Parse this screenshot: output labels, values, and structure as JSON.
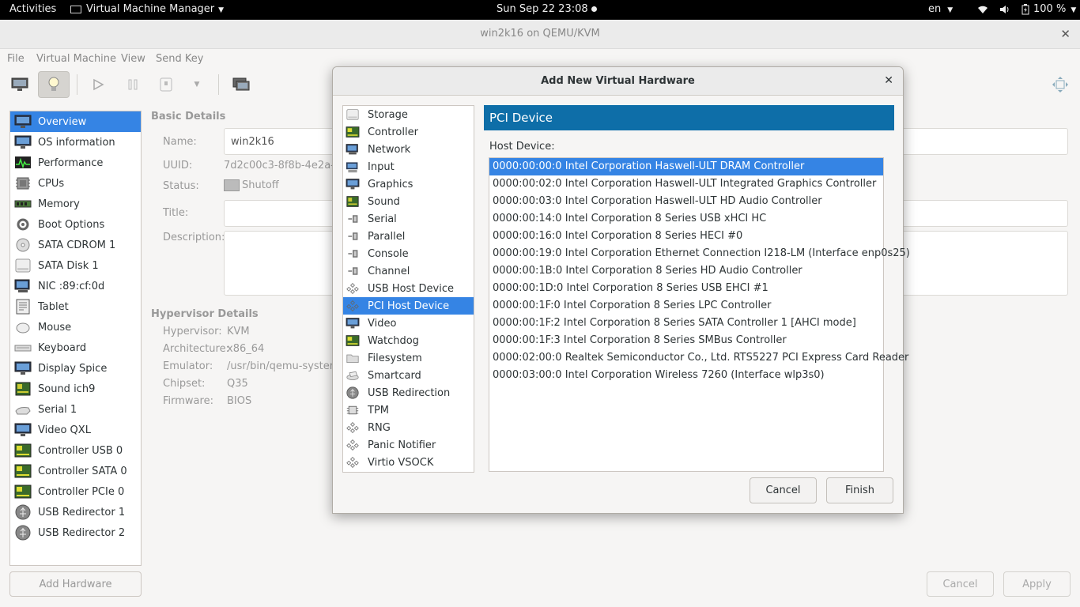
{
  "topbar": {
    "activities": "Activities",
    "app_name": "Virtual Machine Manager",
    "clock": "Sun Sep 22  23:08",
    "lang": "en",
    "battery": "100 %"
  },
  "window": {
    "title": "win2k16 on QEMU/KVM",
    "close": "✕"
  },
  "menu": [
    "File",
    "Virtual Machine",
    "View",
    "Send Key"
  ],
  "hardware_list": {
    "items": [
      {
        "label": "Overview",
        "icon": "monitor-icon"
      },
      {
        "label": "OS information",
        "icon": "monitor-icon"
      },
      {
        "label": "Performance",
        "icon": "performance-icon"
      },
      {
        "label": "CPUs",
        "icon": "cpu-icon"
      },
      {
        "label": "Memory",
        "icon": "memory-icon"
      },
      {
        "label": "Boot Options",
        "icon": "gear-icon"
      },
      {
        "label": "SATA CDROM 1",
        "icon": "cdrom-icon"
      },
      {
        "label": "SATA Disk 1",
        "icon": "disk-icon"
      },
      {
        "label": "NIC :89:cf:0d",
        "icon": "network-icon"
      },
      {
        "label": "Tablet",
        "icon": "tablet-icon"
      },
      {
        "label": "Mouse",
        "icon": "mouse-icon"
      },
      {
        "label": "Keyboard",
        "icon": "keyboard-icon"
      },
      {
        "label": "Display Spice",
        "icon": "monitor-icon"
      },
      {
        "label": "Sound ich9",
        "icon": "sound-card-icon"
      },
      {
        "label": "Serial 1",
        "icon": "serial-icon"
      },
      {
        "label": "Video QXL",
        "icon": "monitor-icon"
      },
      {
        "label": "Controller USB 0",
        "icon": "card-icon"
      },
      {
        "label": "Controller SATA 0",
        "icon": "card-icon"
      },
      {
        "label": "Controller PCIe 0",
        "icon": "card-icon"
      },
      {
        "label": "USB Redirector 1",
        "icon": "usb-icon"
      },
      {
        "label": "USB Redirector 2",
        "icon": "usb-icon"
      }
    ],
    "add_button": "Add Hardware"
  },
  "details": {
    "basic_header": "Basic Details",
    "name_label": "Name:",
    "name_value": "win2k16",
    "uuid_label": "UUID:",
    "uuid_value": "7d2c00c3-8f8b-4e2a-a",
    "status_label": "Status:",
    "status_value": "Shutoff",
    "title_label": "Title:",
    "description_label": "Description:",
    "hypervisor_header": "Hypervisor Details",
    "hypervisor_label": "Hypervisor:",
    "hypervisor_value": "KVM",
    "architecture_label": "Architecture:",
    "architecture_value": "x86_64",
    "emulator_label": "Emulator:",
    "emulator_value": "/usr/bin/qemu-system-",
    "chipset_label": "Chipset:",
    "chipset_value": "Q35",
    "firmware_label": "Firmware:",
    "firmware_value": "BIOS",
    "cancel": "Cancel",
    "apply": "Apply"
  },
  "dialog": {
    "title": "Add New Virtual Hardware",
    "close": "✕",
    "types": [
      {
        "label": "Storage",
        "icon": "disk-icon"
      },
      {
        "label": "Controller",
        "icon": "card-icon"
      },
      {
        "label": "Network",
        "icon": "network-icon"
      },
      {
        "label": "Input",
        "icon": "input-icon"
      },
      {
        "label": "Graphics",
        "icon": "monitor-icon"
      },
      {
        "label": "Sound",
        "icon": "sound-card-icon"
      },
      {
        "label": "Serial",
        "icon": "plug-icon"
      },
      {
        "label": "Parallel",
        "icon": "plug-icon"
      },
      {
        "label": "Console",
        "icon": "plug-icon"
      },
      {
        "label": "Channel",
        "icon": "plug-icon"
      },
      {
        "label": "USB Host Device",
        "icon": "device-icon"
      },
      {
        "label": "PCI Host Device",
        "icon": "device-icon"
      },
      {
        "label": "Video",
        "icon": "monitor-icon"
      },
      {
        "label": "Watchdog",
        "icon": "card-icon"
      },
      {
        "label": "Filesystem",
        "icon": "folder-icon"
      },
      {
        "label": "Smartcard",
        "icon": "smartcard-icon"
      },
      {
        "label": "USB Redirection",
        "icon": "usb-icon"
      },
      {
        "label": "TPM",
        "icon": "chip-icon"
      },
      {
        "label": "RNG",
        "icon": "device-icon"
      },
      {
        "label": "Panic Notifier",
        "icon": "device-icon"
      },
      {
        "label": "Virtio VSOCK",
        "icon": "device-icon"
      }
    ],
    "section_header": "PCI Device",
    "host_device_label": "Host Device:",
    "devices": [
      "0000:00:00:0 Intel Corporation Haswell-ULT DRAM Controller",
      "0000:00:02:0 Intel Corporation Haswell-ULT Integrated Graphics Controller",
      "0000:00:03:0 Intel Corporation Haswell-ULT HD Audio Controller",
      "0000:00:14:0 Intel Corporation 8 Series USB xHCI HC",
      "0000:00:16:0 Intel Corporation 8 Series HECI #0",
      "0000:00:19:0 Intel Corporation Ethernet Connection I218-LM (Interface enp0s25)",
      "0000:00:1B:0 Intel Corporation 8 Series HD Audio Controller",
      "0000:00:1D:0 Intel Corporation 8 Series USB EHCI #1",
      "0000:00:1F:0 Intel Corporation 8 Series LPC Controller",
      "0000:00:1F:2 Intel Corporation 8 Series SATA Controller 1 [AHCI mode]",
      "0000:00:1F:3 Intel Corporation 8 Series SMBus Controller",
      "0000:02:00:0 Realtek Semiconductor Co., Ltd. RTS5227 PCI Express Card Reader",
      "0000:03:00:0 Intel Corporation Wireless 7260 (Interface wlp3s0)"
    ],
    "cancel": "Cancel",
    "finish": "Finish"
  }
}
